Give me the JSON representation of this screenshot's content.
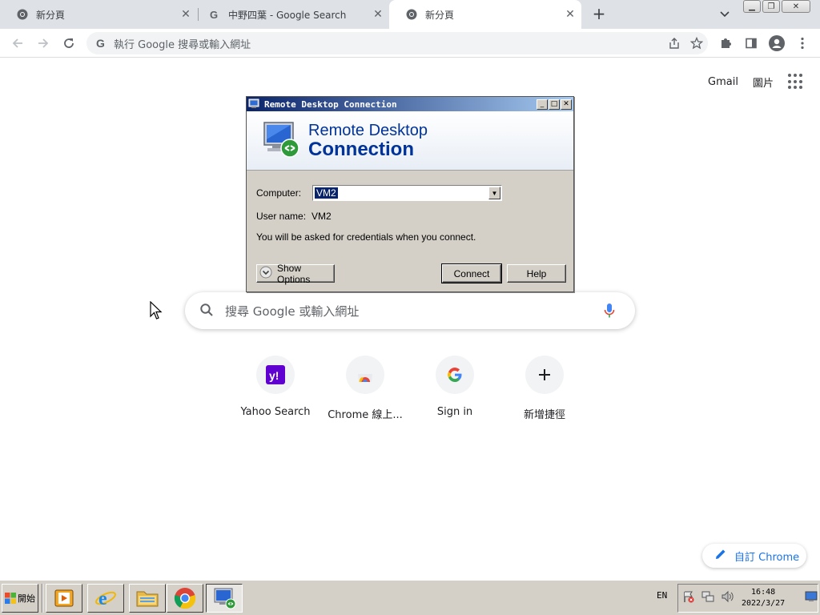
{
  "browser": {
    "tabs": [
      {
        "title": "新分頁",
        "active": false
      },
      {
        "title": "中野四葉 - Google Search",
        "active": false
      },
      {
        "title": "新分頁",
        "active": true
      }
    ],
    "omnibox_placeholder": "執行 Google 搜尋或輸入網址"
  },
  "ntp": {
    "gmail": "Gmail",
    "images": "圖片",
    "search_placeholder": "搜尋 Google 或輸入網址",
    "shortcuts": [
      {
        "label": "Yahoo Search",
        "icon": "yahoo-icon"
      },
      {
        "label": "Chrome 線上...",
        "icon": "chrome-webstore-icon"
      },
      {
        "label": "Sign in",
        "icon": "google-icon"
      },
      {
        "label": "新增捷徑",
        "icon": "plus-icon"
      }
    ],
    "customize_label": "自訂 Chrome"
  },
  "rdp": {
    "title": "Remote Desktop Connection",
    "banner_line1": "Remote Desktop",
    "banner_line2": "Connection",
    "computer_label": "Computer:",
    "computer_value": "VM2",
    "username_label": "User name:",
    "username_value": "VM2",
    "info": "You will be asked for credentials when you connect.",
    "show_options": "Show Options",
    "connect": "Connect",
    "help": "Help"
  },
  "taskbar": {
    "start_label": "開始",
    "language": "EN",
    "time": "16:48",
    "date": "2022/3/27",
    "apps": [
      "media-player-icon",
      "internet-explorer-icon",
      "file-explorer-icon",
      "chrome-icon",
      "remote-desktop-icon"
    ]
  },
  "colors": {
    "chrome_tabstrip": "#dee1e6",
    "google_blue": "#1a73e8",
    "win_face": "#d4d0c8",
    "rdp_title_blue": "#0a246a"
  }
}
